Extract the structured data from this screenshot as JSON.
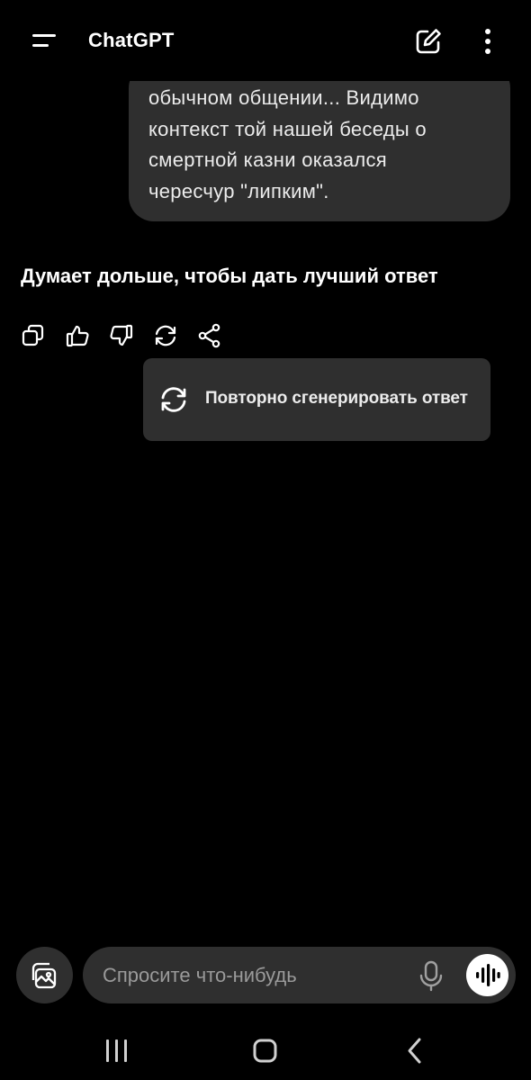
{
  "header": {
    "title": "ChatGPT",
    "menu_icon": "menu-icon",
    "new_chat_icon": "new-chat-icon",
    "more_icon": "more-vertical-icon"
  },
  "conversation": {
    "user_message": "обычном общении... Видимо\nконтекст той нашей беседы о\nсмертной казни оказался\nчересчур \"липким\".",
    "assistant_status": "Думает дольше, чтобы дать лучший ответ",
    "actions": [
      {
        "icon": "copy-icon"
      },
      {
        "icon": "thumbs-up-icon"
      },
      {
        "icon": "thumbs-down-icon"
      },
      {
        "icon": "regenerate-icon"
      },
      {
        "icon": "share-icon"
      }
    ]
  },
  "popup": {
    "label": "Повторно сгенерировать ответ",
    "icon": "regenerate-icon"
  },
  "composer": {
    "placeholder": "Спросите что-нибудь",
    "attach_icon": "image-gallery-icon",
    "mic_icon": "microphone-icon",
    "voice_icon": "voice-mode-icon"
  },
  "system_nav": {
    "recents_icon": "recents-icon",
    "home_icon": "home-icon",
    "back_icon": "back-icon"
  },
  "colors": {
    "background": "#000000",
    "bubble": "#2f2f2f",
    "text": "#ffffff",
    "placeholder": "#9a9a9a"
  }
}
